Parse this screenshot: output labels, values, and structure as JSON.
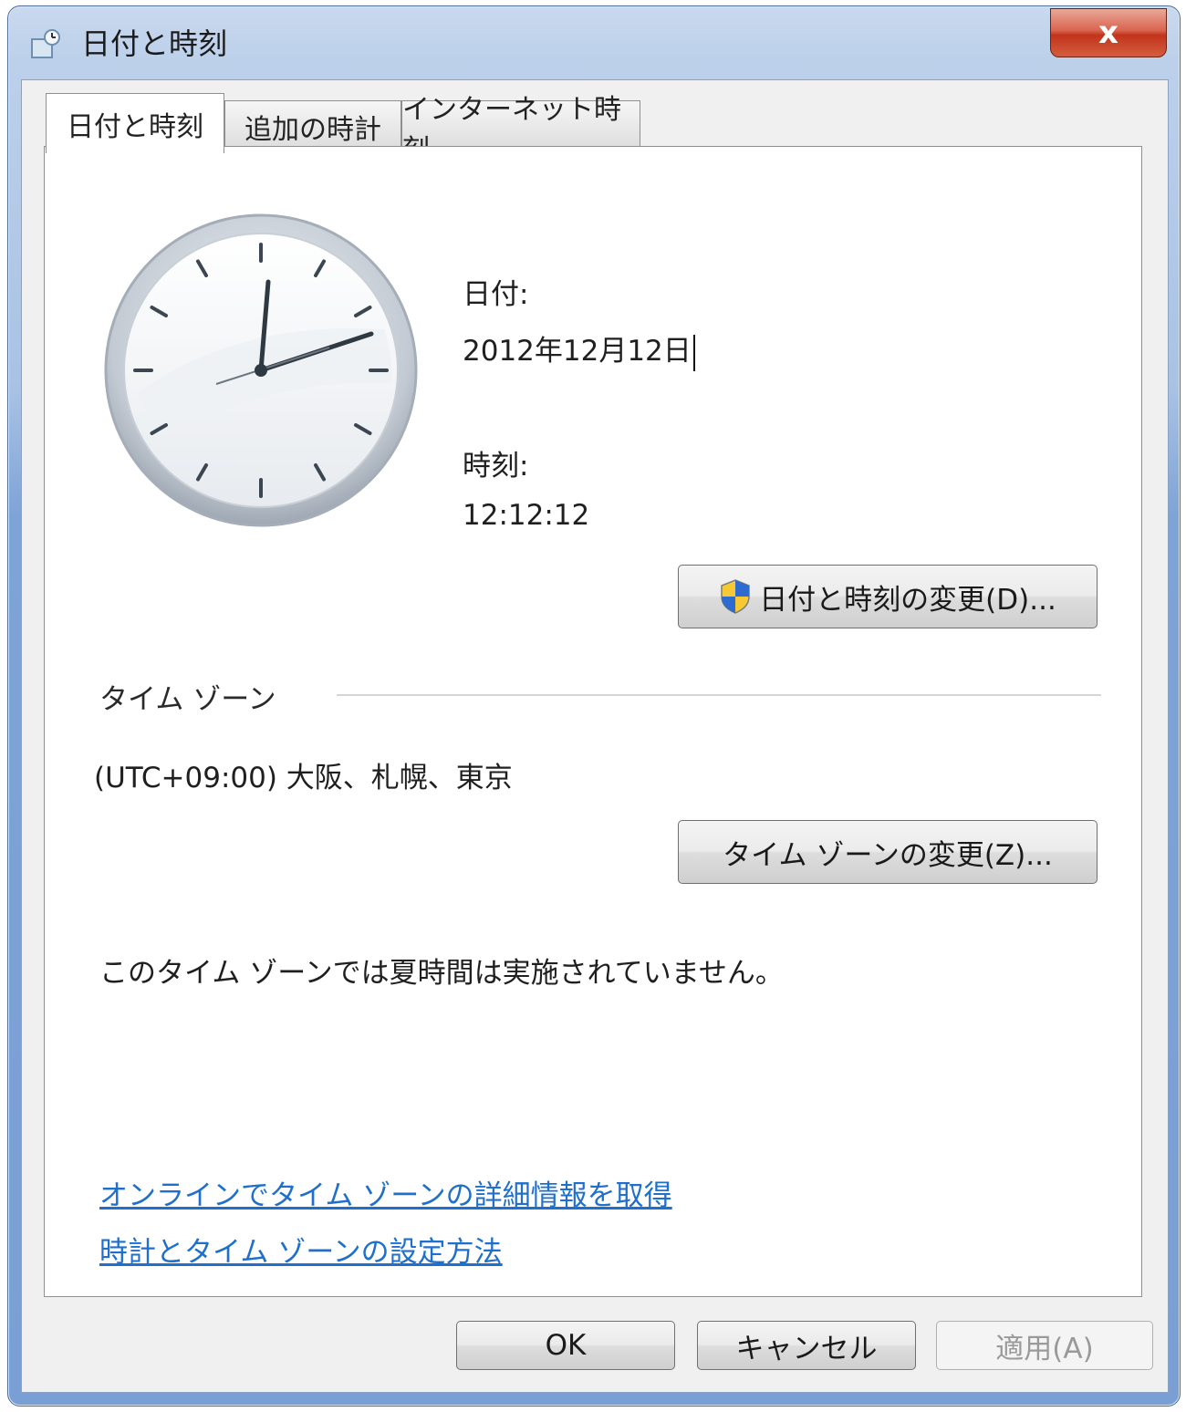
{
  "window": {
    "title": "日付と時刻",
    "close_label": "x"
  },
  "tabs": [
    {
      "label": "日付と時刻",
      "active": true
    },
    {
      "label": "追加の時計",
      "active": false
    },
    {
      "label": "インターネット時刻",
      "active": false
    }
  ],
  "date_time": {
    "date_label": "日付:",
    "date_value": "2012年12月12日",
    "time_label": "時刻:",
    "time_value": "12:12:12",
    "change_button": "日付と時刻の変更(D)..."
  },
  "time_zone": {
    "section_label": "タイム ゾーン",
    "value": "(UTC+09:00) 大阪、札幌、東京",
    "change_button": "タイム ゾーンの変更(Z)...",
    "dst_note": "このタイム ゾーンでは夏時間は実施されていません。"
  },
  "links": {
    "online_info": "オンラインでタイム ゾーンの詳細情報を取得",
    "how_to": "時計とタイム ゾーンの設定方法"
  },
  "dialog_buttons": {
    "ok": "OK",
    "cancel": "キャンセル",
    "apply": "適用(A)"
  },
  "colors": {
    "link": "#1f6fcc",
    "close_button": "#c1341b"
  },
  "icons": {
    "app": "datetime-icon",
    "uac": "uac-shield-icon"
  }
}
